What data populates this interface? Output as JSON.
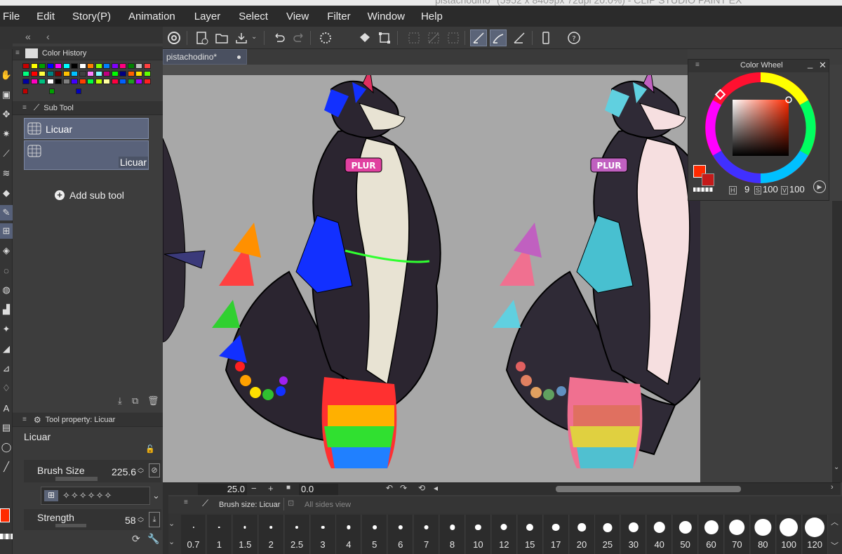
{
  "titlebar": {
    "text": "pistachodino* (5952 x 8409px 72dpi 20.0%) - CLIP STUDIO PAINT EX"
  },
  "menu": [
    "File",
    "Edit",
    "Story(P)",
    "Animation",
    "Layer",
    "Select",
    "View",
    "Filter",
    "Window",
    "Help"
  ],
  "color_history": {
    "title": "Color History",
    "swatches_row1": [
      "#c80000",
      "#ffff00",
      "#00a000",
      "#0000ff",
      "#ff00ff",
      "#00ffff",
      "#000000",
      "#ffffff",
      "#ff8000",
      "#80ff00",
      "#0080ff",
      "#8000ff",
      "#ff0080",
      "#008000",
      "#c0c0c0",
      "#ff4040",
      "#40ff40",
      "#4040ff"
    ],
    "swatches_row2": [
      "#00ff80",
      "#ff0000",
      "#ffff40",
      "#008080",
      "#800000",
      "#ffc000",
      "#00c0ff",
      "#404040",
      "#ff80ff",
      "#80ffff",
      "#c00080",
      "#00ff00",
      "#000080",
      "#ff6000",
      "#ffe000",
      "#60ff00"
    ],
    "swatches_row3": [
      "#0000a0",
      "#ff00c0",
      "#00c080",
      "#ffffff",
      "#000000",
      "#808080",
      "#4000ff",
      "#ff4000",
      "#00ff40",
      "#c0ff00",
      "#ffffa0",
      "#ff0040",
      "#0060ff",
      "#20a020",
      "#a000ff",
      "#ff2020"
    ],
    "swatches_row4": [
      "#c00000",
      "#00a000",
      "#0000c0"
    ]
  },
  "sub_tool": {
    "title": "Sub Tool",
    "items": [
      "Licuar",
      "Licuar"
    ],
    "add_label": "Add sub tool"
  },
  "tool_property": {
    "title": "Tool property: Licuar",
    "tool_name": "Licuar",
    "brush_size_label": "Brush Size",
    "brush_size_value": "225.6",
    "strength_label": "Strength",
    "strength_value": "58"
  },
  "document": {
    "tab_label": "pistachodino*"
  },
  "canvas_status": {
    "zoom": "25.0",
    "rotation": "0.0"
  },
  "color_wheel": {
    "title": "Color Wheel",
    "h_label": "H",
    "h_value": "9",
    "s_label": "S",
    "s_value": "100",
    "v_label": "V",
    "v_value": "100",
    "main_color": "#ff2a00",
    "sub_color": "#c41a1a"
  },
  "brush_size_panel": {
    "title": "Brush size: Licuar",
    "all_sides_label": "All sides view",
    "sizes": [
      "0.7",
      "1",
      "1.5",
      "2",
      "2.5",
      "3",
      "4",
      "5",
      "6",
      "7",
      "8",
      "10",
      "12",
      "15",
      "17",
      "20",
      "25",
      "30",
      "40",
      "50",
      "60",
      "70",
      "80",
      "100",
      "120"
    ]
  },
  "colors": {
    "accent": "#5b6478",
    "panel_bg": "#3d3d3d",
    "canvas_bg": "#a8a8a8"
  }
}
